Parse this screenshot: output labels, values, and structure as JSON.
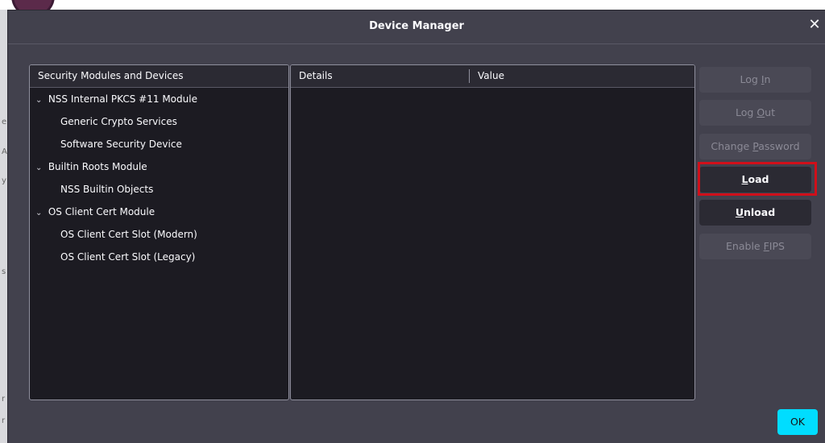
{
  "dialog": {
    "title": "Device Manager",
    "close_glyph": "✕"
  },
  "tree": {
    "header": "Security Modules and Devices",
    "expander_glyph": "⌄",
    "modules": [
      {
        "label": "NSS Internal PKCS #11 Module",
        "devices": [
          "Generic Crypto Services",
          "Software Security Device"
        ]
      },
      {
        "label": "Builtin Roots Module",
        "devices": [
          "NSS Builtin Objects"
        ]
      },
      {
        "label": "OS Client Cert Module",
        "devices": [
          "OS Client Cert Slot (Modern)",
          "OS Client Cert Slot (Legacy)"
        ]
      }
    ]
  },
  "details": {
    "col_details": "Details",
    "col_value": "Value"
  },
  "buttons": {
    "login": {
      "pre": "Log ",
      "key": "I",
      "post": "n",
      "enabled": false
    },
    "logout": {
      "pre": "Log ",
      "key": "O",
      "post": "ut",
      "enabled": false
    },
    "change_password": {
      "pre": "Change ",
      "key": "P",
      "post": "assword",
      "enabled": false
    },
    "load": {
      "pre": "",
      "key": "L",
      "post": "oad",
      "enabled": true
    },
    "unload": {
      "pre": "",
      "key": "U",
      "post": "nload",
      "enabled": true
    },
    "enable_fips": {
      "pre": "Enable ",
      "key": "F",
      "post": "IPS",
      "enabled": false
    },
    "ok": "OK"
  },
  "colors": {
    "dialog_bg": "#42414d",
    "pane_bg": "#1c1b22",
    "ok_accent": "#00ddff",
    "highlight": "#d00f1a"
  },
  "background_chars": [
    "e",
    "A",
    "y",
    "s",
    "r",
    "r"
  ]
}
